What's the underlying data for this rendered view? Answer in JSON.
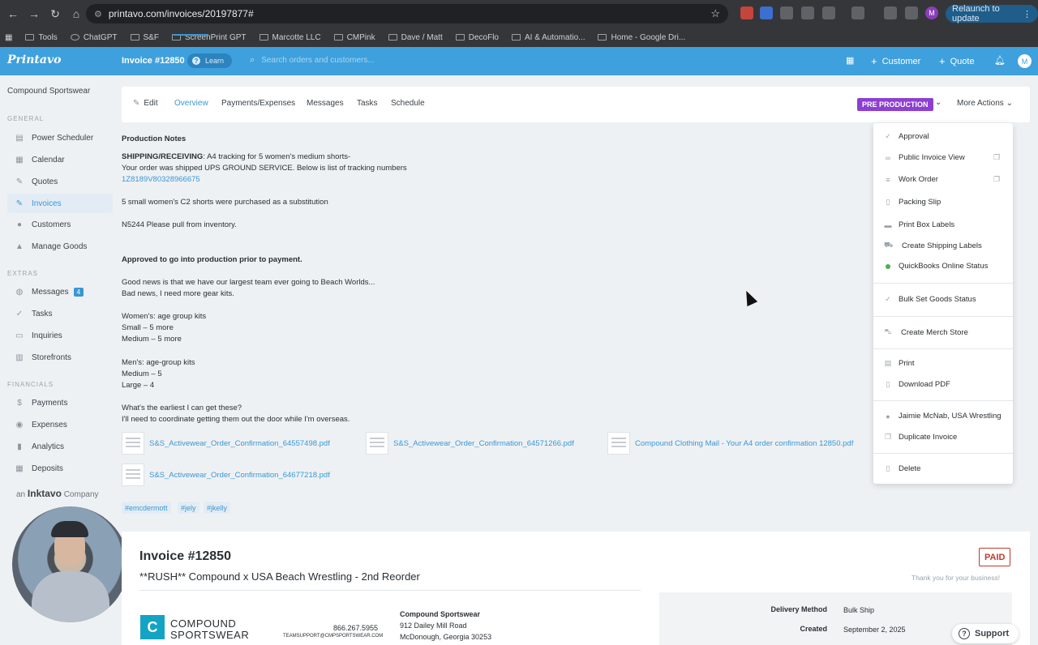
{
  "browser": {
    "url": "printavo.com/invoices/20197877#",
    "relaunch_label": "Relaunch to update",
    "profile_initial": "M",
    "bookmarks": [
      "Tools",
      "ChatGPT",
      "S&F",
      "ScreenPrint GPT",
      "Marcotte LLC",
      "CMPink",
      "Dave / Matt",
      "DecoFlo",
      "AI & Automatio...",
      "Home - Google Dri..."
    ]
  },
  "header": {
    "logo": "Printavo",
    "title": "Invoice #12850",
    "learn_label": "Learn",
    "search_placeholder": "Search orders and customers...",
    "customer_label": "Customer",
    "quote_label": "Quote",
    "avatar_initial": "M",
    "accent_color": "#3ea0dc"
  },
  "sidebar": {
    "company": "Compound Sportswear",
    "general_label": "GENERAL",
    "general": [
      "Power Scheduler",
      "Calendar",
      "Quotes",
      "Invoices",
      "Customers",
      "Manage Goods"
    ],
    "extras_label": "EXTRAS",
    "extras": [
      "Messages",
      "Tasks",
      "Inquiries",
      "Storefronts"
    ],
    "messages_count": "4",
    "financials_label": "FINANCIALS",
    "financials": [
      "Payments",
      "Expenses",
      "Analytics",
      "Deposits"
    ],
    "footer_prefix": "an",
    "footer_brand": "Inktavo",
    "footer_suffix": "Company",
    "active_item": "Invoices"
  },
  "tabs": {
    "items": [
      "Edit",
      "Overview",
      "Payments/Expenses",
      "Messages",
      "Tasks",
      "Schedule"
    ],
    "active": "Overview",
    "status": "PRE PRODUCTION",
    "status_color": "#8e3fd0",
    "more_actions": "More Actions"
  },
  "notes": {
    "heading": "Production Notes",
    "shipping_label": "SHIPPING/RECEIVING",
    "lines": [
      ": A4 tracking for 5 women's medium shorts-",
      "Your order was shipped UPS GROUND SERVICE. Below is list of tracking numbers",
      "1Z8189V80328966675",
      "5 small women's C2 shorts were purchased as a substitution",
      "N5244 Please pull from inventory.",
      "Approved to go into production prior to payment.",
      "Good news is that we have our largest team ever going to Beach Worlds...",
      "Bad news, I need more gear kits.",
      "Women's: age group kits",
      "Small – 5 more",
      "Medium – 5 more",
      "Men's: age-group kits",
      "Medium – 5",
      "Large – 4",
      "What's the earliest I can get these?",
      "I'll need to coordinate getting them out the door while I'm overseas."
    ]
  },
  "attachments": [
    "S&S_Activewear_Order_Confirmation_64557498.pdf",
    "S&S_Activewear_Order_Confirmation_64571266.pdf",
    "Compound Clothing Mail - Your A4 order confirmation 12850.pdf",
    "S&S_Activewear_Order_Confirmation_64677218.pdf"
  ],
  "tags": [
    "#emcdermott",
    "#jely",
    "#jkelly"
  ],
  "dropdown": {
    "items": [
      {
        "label": "Approval",
        "icon": "check-icon"
      },
      {
        "label": "Public Invoice View",
        "icon": "link-icon"
      },
      {
        "label": "Work Order",
        "icon": "list-icon"
      },
      {
        "label": "Packing Slip",
        "icon": "document-icon"
      },
      {
        "label": "Print Box Labels",
        "icon": "box-icon"
      },
      {
        "label": "Create Shipping Labels",
        "icon": "truck-icon"
      },
      {
        "label": "QuickBooks Online Status",
        "icon": "status-dot-icon"
      },
      {
        "label": "Bulk Set Goods Status",
        "icon": "check-icon"
      },
      {
        "label": "Create Merch Store",
        "icon": "cart-icon"
      },
      {
        "label": "Print",
        "icon": "printer-icon"
      },
      {
        "label": "Download PDF",
        "icon": "pdf-icon"
      },
      {
        "label": "Jaimie McNab, USA Wrestling",
        "icon": "user-icon"
      },
      {
        "label": "Duplicate Invoice",
        "icon": "duplicate-icon"
      },
      {
        "label": "Delete",
        "icon": "trash-icon"
      }
    ]
  },
  "invoice": {
    "title": "Invoice #12850",
    "subtitle": "**RUSH** Compound x USA Beach Wrestling - 2nd Reorder",
    "paid_label": "PAID",
    "thanks": "Thank you for your business!",
    "logo_line1": "COMPOUND",
    "logo_line2": "SPORTSWEAR",
    "phone": "866.267.5955",
    "email": "TEAMSUPPORT@CMPSPORTSWEAR.COM",
    "company": "Compound Sportswear",
    "address1": "912 Dailey Mill Road",
    "address2": "McDonough, Georgia 30253",
    "delivery_label": "Delivery Method",
    "delivery_value": "Bulk Ship",
    "created_label": "Created",
    "created_value": "September 2, 2025"
  },
  "support_label": "Support"
}
